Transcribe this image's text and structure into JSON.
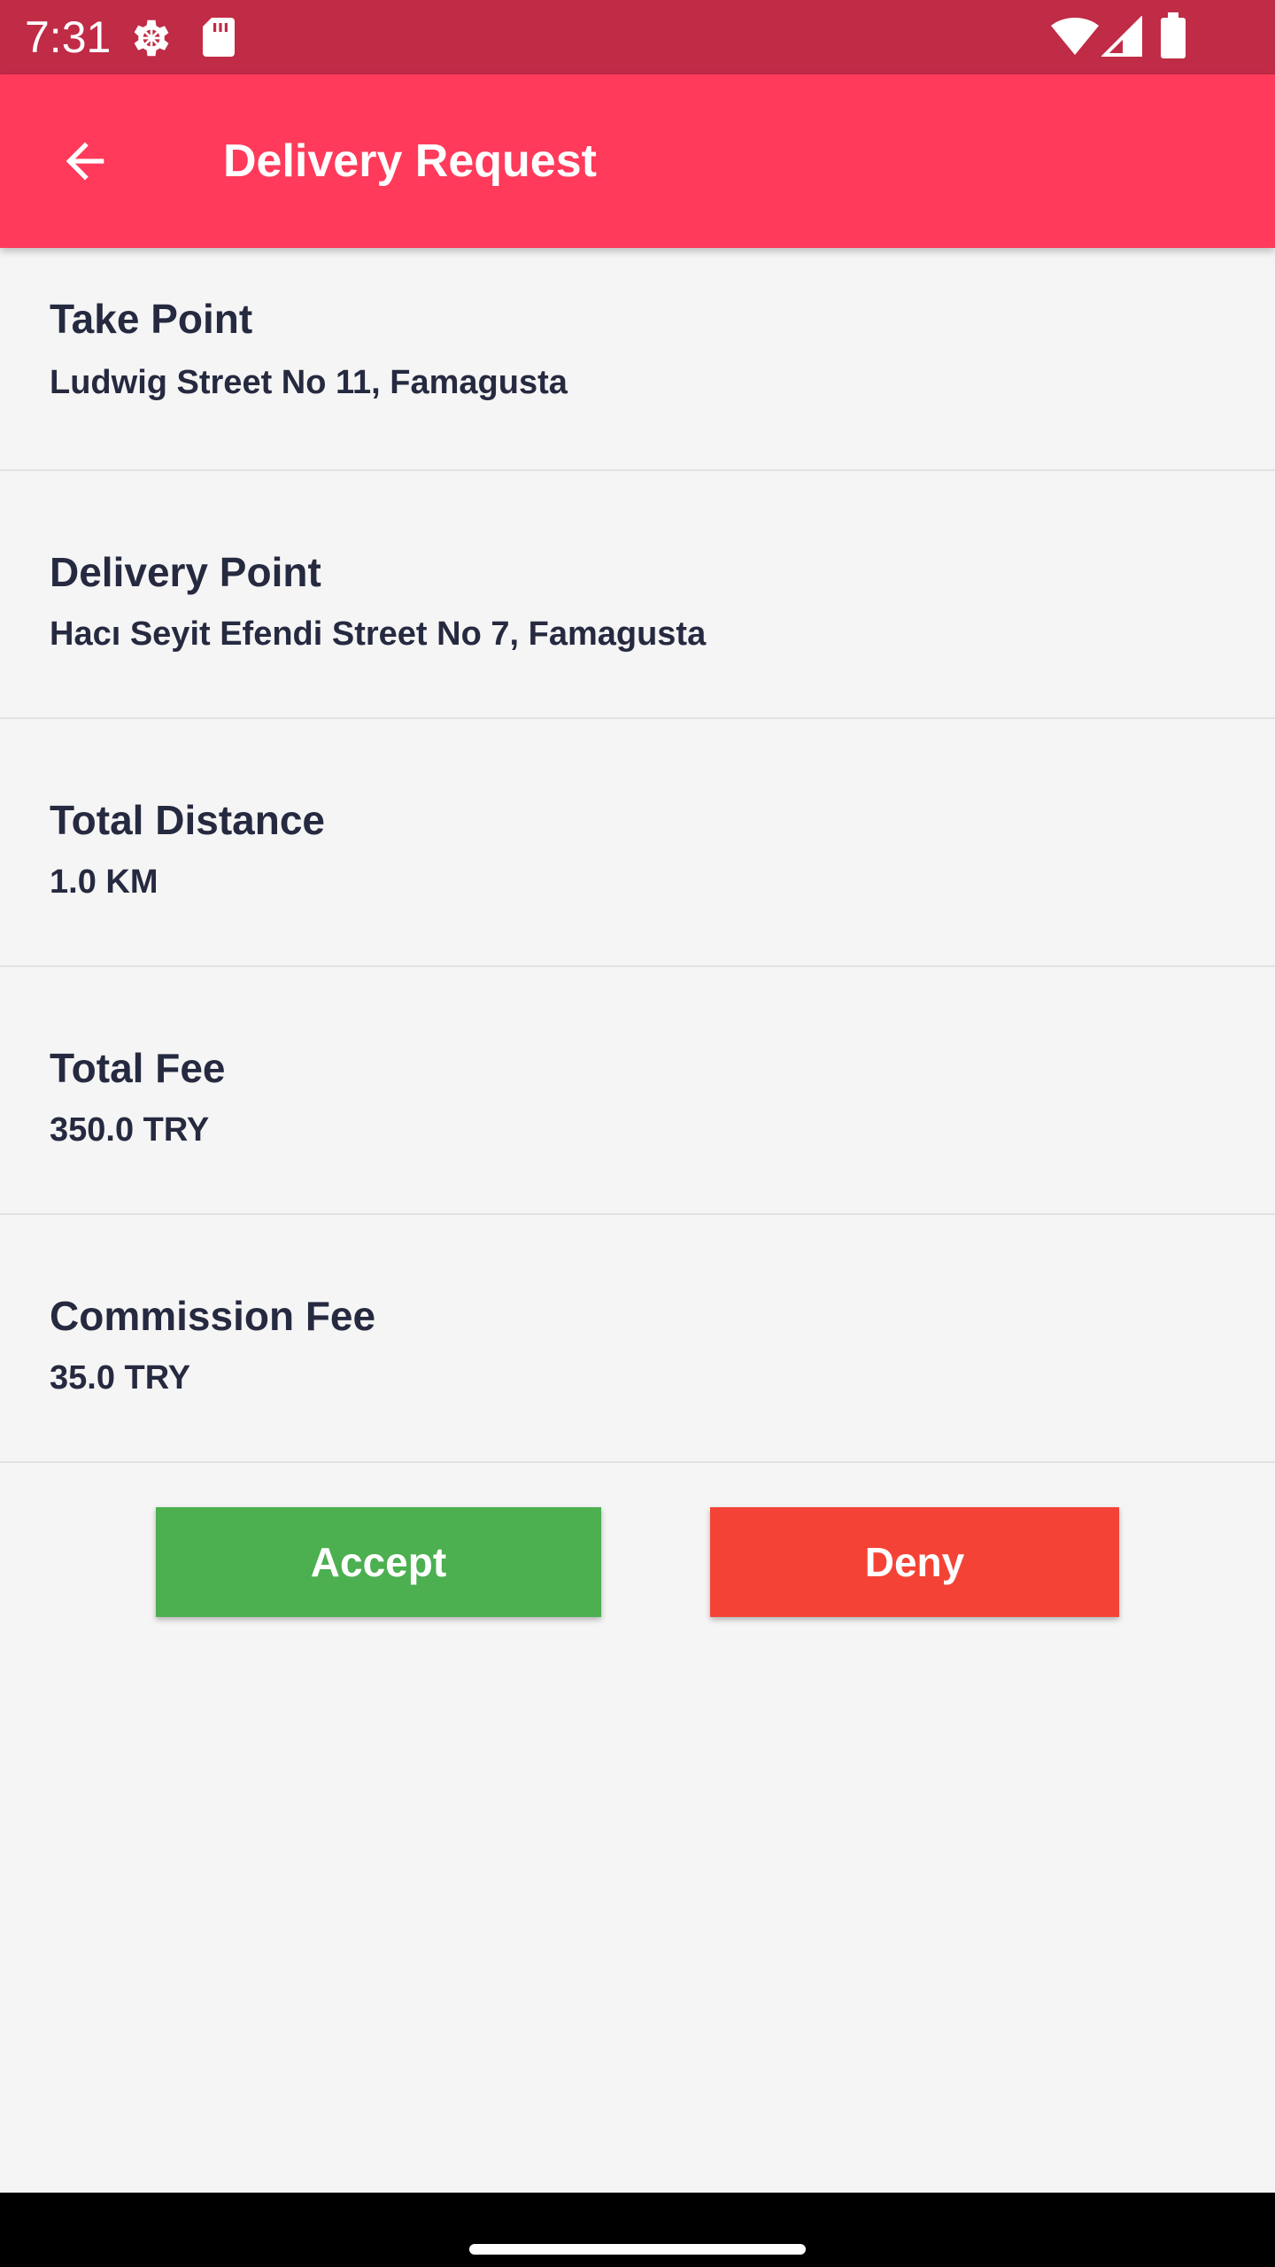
{
  "status_bar": {
    "time": "7:31",
    "icons": [
      "gear-icon",
      "sd-card-icon",
      "wifi-icon",
      "signal-icon",
      "battery-icon"
    ],
    "color": "#c02b46"
  },
  "app_bar": {
    "title": "Delivery Request",
    "back_icon": "arrow-back-icon",
    "color": "#ff3a5b"
  },
  "details": [
    {
      "label": "Take Point",
      "value": "Ludwig Street No 11, Famagusta"
    },
    {
      "label": "Delivery Point",
      "value": "Hacı Seyit Efendi Street No 7, Famagusta"
    },
    {
      "label": "Total Distance",
      "value": "1.0 KM"
    },
    {
      "label": "Total Fee",
      "value": "350.0 TRY"
    },
    {
      "label": "Commission Fee",
      "value": "35.0 TRY"
    }
  ],
  "actions": {
    "accept_label": "Accept",
    "accept_color": "#4caf50",
    "deny_label": "Deny",
    "deny_color": "#f44336"
  }
}
